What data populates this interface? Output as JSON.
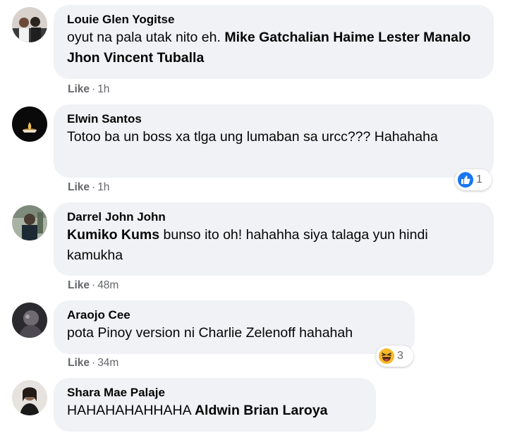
{
  "comments": [
    {
      "author": "Louie Glen Yogitse",
      "segments": [
        {
          "text": "oyut na pala utak nito eh. ",
          "bold": false
        },
        {
          "text": "Mike Gatchalian Haime Lester Manalo Jhon Vincent Tuballa",
          "bold": true
        }
      ],
      "like_label": "Like",
      "time": "1h"
    },
    {
      "author": "Elwin Santos",
      "segments": [
        {
          "text": "Totoo ba un boss xa tlga ung lumaban sa urcc??? Hahahaha",
          "bold": false
        }
      ],
      "like_label": "Like",
      "time": "1h",
      "reaction": {
        "icon": "like-reaction-icon",
        "count": "1"
      }
    },
    {
      "author": "Darrel John John",
      "segments": [
        {
          "text": "Kumiko Kums",
          "bold": true
        },
        {
          "text": " bunso ito oh! hahahha siya talaga yun hindi kamukha",
          "bold": false
        }
      ],
      "like_label": "Like",
      "time": "48m"
    },
    {
      "author": "Araojo Cee",
      "segments": [
        {
          "text": "pota Pinoy version ni Charlie Zelenoff hahahah",
          "bold": false
        }
      ],
      "like_label": "Like",
      "time": "34m",
      "reaction": {
        "icon": "haha-reaction-icon",
        "count": "3"
      }
    },
    {
      "author": "Shara Mae Palaje",
      "segments": [
        {
          "text": "HAHAHAHAHHAHA ",
          "bold": false
        },
        {
          "text": "Aldwin Brian Laroya",
          "bold": true
        }
      ]
    }
  ],
  "colors": {
    "bubble": "#f0f2f5",
    "meta": "#65676b",
    "like_blue": "#1877f2",
    "haha_yellow": "#f7b928"
  }
}
